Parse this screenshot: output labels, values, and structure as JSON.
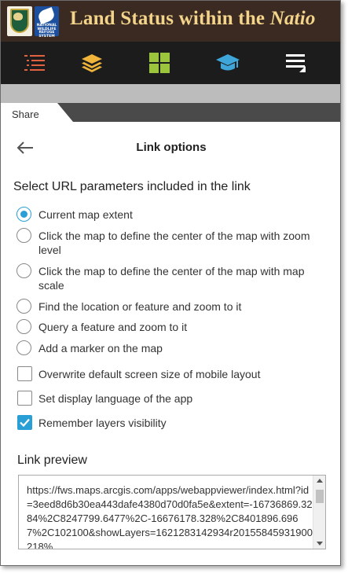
{
  "header": {
    "title_main": "Land Status within the ",
    "title_italic": "Natio",
    "logo2_text": "NATIONAL WILDLIFE REFUGE SYSTEM"
  },
  "toolbar": {
    "buttons": [
      {
        "name": "legend",
        "icon": "list-icon",
        "color": "#e2613e"
      },
      {
        "name": "layers",
        "icon": "layers-icon",
        "color": "#f0b43b"
      },
      {
        "name": "basemap",
        "icon": "grid-icon",
        "color": "#9bc53d"
      },
      {
        "name": "about",
        "icon": "graduation-cap-icon",
        "color": "#3ea6d8"
      },
      {
        "name": "more",
        "icon": "menu-icon",
        "color": "#ffffff"
      }
    ]
  },
  "tab": {
    "label": "Share"
  },
  "panel": {
    "title": "Link options",
    "section_title": "Select URL parameters included in the link",
    "radio_options": [
      {
        "label": "Current map extent",
        "selected": true
      },
      {
        "label": "Click the map to define the center of the map with zoom level",
        "selected": false
      },
      {
        "label": "Click the map to define the center of the map with map scale",
        "selected": false
      },
      {
        "label": "Find the location or feature and zoom to it",
        "selected": false
      },
      {
        "label": "Query a feature and zoom to it",
        "selected": false
      },
      {
        "label": "Add a marker on the map",
        "selected": false
      }
    ],
    "checkboxes": [
      {
        "label": "Overwrite default screen size of mobile layout",
        "checked": false
      },
      {
        "label": "Set display language of the app",
        "checked": false
      },
      {
        "label": "Remember layers visibility",
        "checked": true
      }
    ],
    "preview_title": "Link preview",
    "preview_url": "https://fws.maps.arcgis.com/apps/webappviewer/index.html?id=3eed8d6b30ea443dafe4380d70d0fa5e&extent=-16736869.3284%2C8247799.6477%2C-16676178.328%2C8401896.6967%2C102100&showLayers=1621283142934r20155845931900218%"
  },
  "colors": {
    "accent": "#2a9fd6",
    "header_bg": "#3a2a21",
    "toolbar_bg": "#1c1c1c",
    "title_gold": "#f3d48a"
  }
}
